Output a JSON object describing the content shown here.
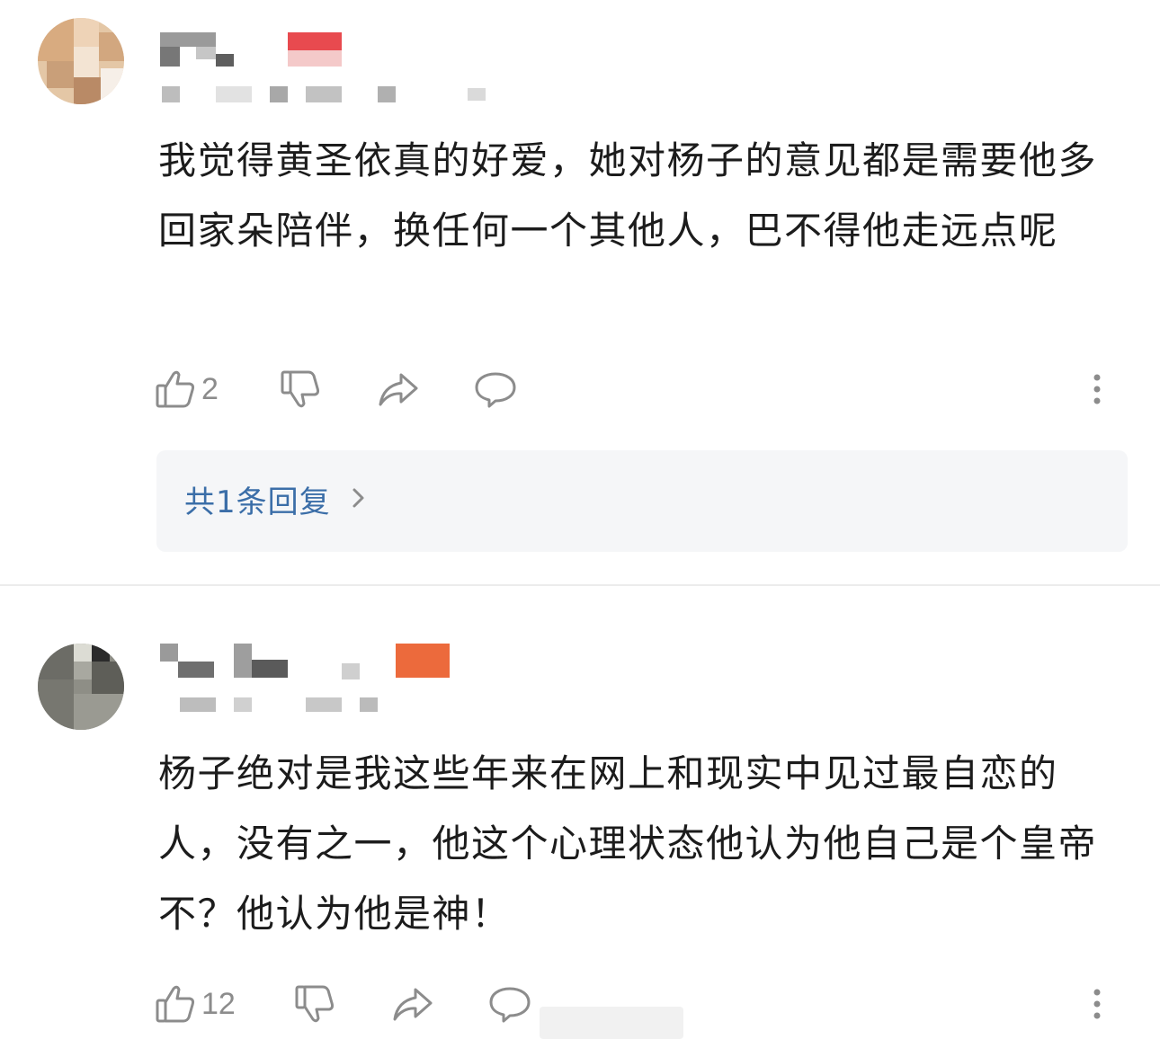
{
  "comments": [
    {
      "text": "我觉得黄圣依真的好爱，她对杨子的意见都是需要他多回家朵陪伴，换任何一个其他人，巴不得他走远点呢",
      "likes": "2",
      "reply_summary": "共1条回复"
    },
    {
      "text": "杨子绝对是我这些年来在网上和现实中见过最自恋的人，没有之一，他这个心理状态他认为他自己是个皇帝不？他认为他是神！",
      "likes": "12"
    }
  ],
  "icons": {
    "like": "thumbs-up-icon",
    "dislike": "thumbs-down-icon",
    "share": "share-arrow-icon",
    "comment": "speech-bubble-icon",
    "more": "vertical-dots-icon",
    "chevron": "chevron-right-icon"
  },
  "colors": {
    "reply_link": "#3b6ea8",
    "badge_1": "#e84a4f",
    "badge_2": "#ec6a3c",
    "icon_gray": "#8c8c8c"
  }
}
